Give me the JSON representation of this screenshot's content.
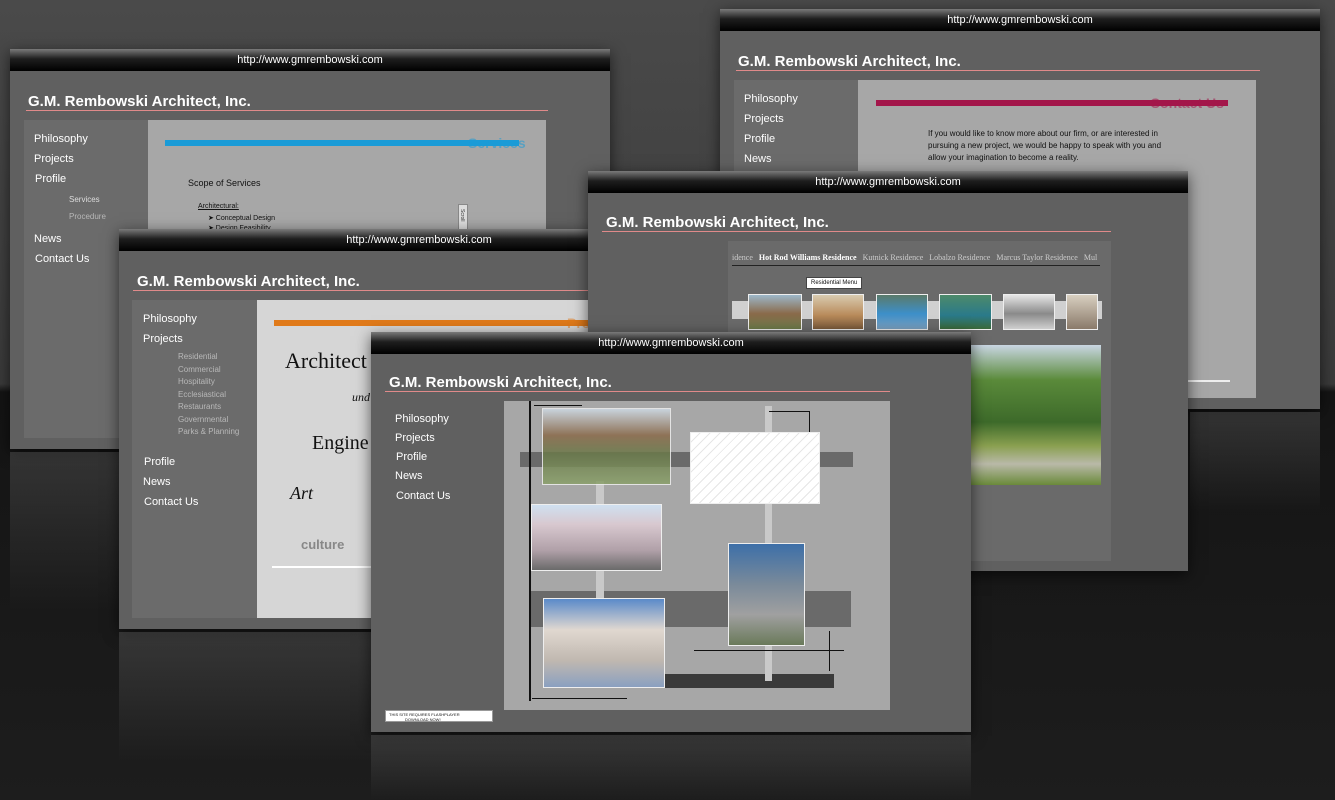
{
  "url": "http://www.gmrembowski.com",
  "site_title": "G.M. Rembowski Architect, Inc.",
  "nav_main": {
    "philosophy": "Philosophy",
    "projects": "Projects",
    "profile": "Profile",
    "news": "News",
    "contact": "Contact Us"
  },
  "profile_sub": {
    "services": "Services",
    "procedure": "Procedure"
  },
  "projects_sub": [
    "Residential",
    "Commercial",
    "Hospitality",
    "Ecclesiastical",
    "Restaurants",
    "Governmental",
    "Parks & Planning"
  ],
  "services_page": {
    "heading": "Services",
    "scope": "Scope of Services",
    "architectural": "Architectural:",
    "item1": "➤ Conceptual Design",
    "item2": "➤ Design Feasibility",
    "scroll_label": "Scroll"
  },
  "contact_page": {
    "heading": "Contact Us",
    "line1": "If you would like to know more about our firm, or are interested in",
    "line2": "pursuing a new project, we would be happy to speak with you and",
    "line3": "allow your imagination to become a reality."
  },
  "residential_page": {
    "menu": [
      "idence",
      "Hot Rod Williams Residence",
      "Kutnick Residence",
      "Lobalzo Residence",
      "Marcus Taylor Residence",
      "Mul"
    ],
    "tooltip": "Residential Menu"
  },
  "projects_page": {
    "heading": "Projects",
    "words": {
      "w1": "Architect",
      "w2": "und",
      "w3": "Engine",
      "w4": "Art",
      "w5": "culture"
    }
  },
  "flash": {
    "line1": "THIS SITE REQUIRES FLASHPLAYER",
    "line2": "DOWNLOAD NOW!"
  },
  "colors": {
    "services": "#1a9bd7",
    "contact": "#a3164a",
    "projects": "#e07a1a",
    "accent_rule": "#e08a8a"
  }
}
